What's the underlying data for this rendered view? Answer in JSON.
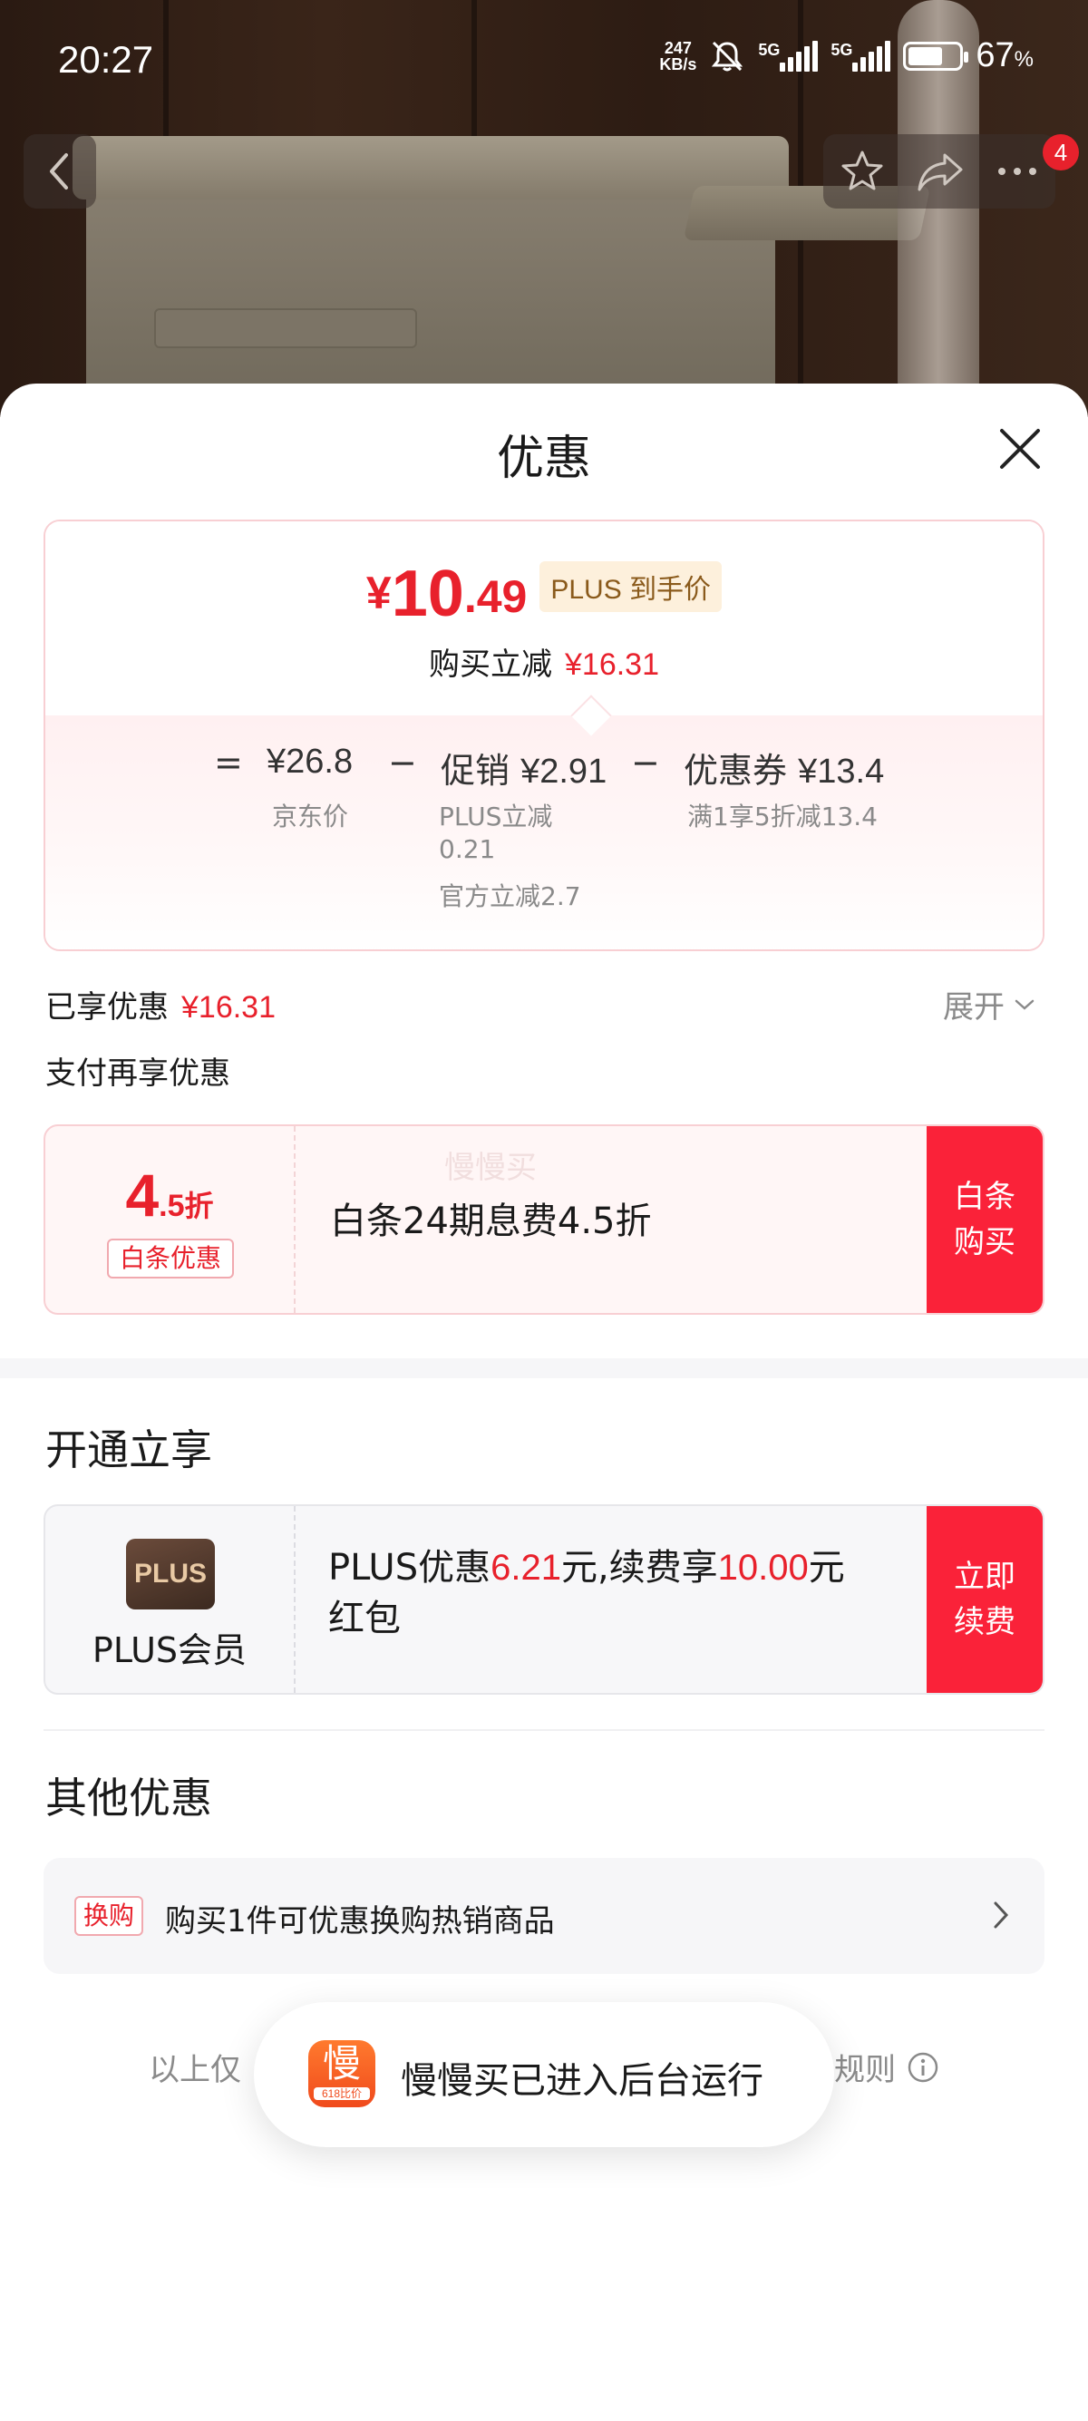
{
  "status_bar": {
    "time": "20:27",
    "net_speed_value": "247",
    "net_speed_unit": "KB/s",
    "signal1_label": "5G",
    "signal2_label": "5G",
    "battery_level": 0.67,
    "battery_pct": "67",
    "battery_pct_unit": "%"
  },
  "nav": {
    "badge_count": "4"
  },
  "sheet": {
    "title": "优惠"
  },
  "price_card": {
    "currency": "¥",
    "price_int": "10",
    "price_dec": ".49",
    "plus_tag_prefix": "PLUS",
    "plus_tag_suffix": "到手价",
    "reduce_label": "购买立减",
    "reduce_value": "¥16.31",
    "eq_sign": "=",
    "jd_price": "¥26.8",
    "jd_price_label": "京东价",
    "minus1": "−",
    "promo_label": "促销",
    "promo_value": "¥2.91",
    "promo_detail1_a": "PLUS立减",
    "promo_detail1_b": "0.21",
    "promo_detail2": "官方立减2.7",
    "minus2": "−",
    "coupon_label": "优惠券",
    "coupon_value": "¥13.4",
    "coupon_detail": "满1享5折减13.4"
  },
  "enjoyed": {
    "label": "已享优惠",
    "value": "¥16.31",
    "expand_label": "展开"
  },
  "pay_more": {
    "label": "支付再享优惠"
  },
  "baitiao": {
    "rate_big": "4",
    "rate_small": ".5",
    "rate_unit": "折",
    "tag": "白条优惠",
    "text": "白条24期息费4.5折",
    "watermark": "慢慢买",
    "button_line1": "白条",
    "button_line2": "购买"
  },
  "open_section": {
    "title": "开通立享"
  },
  "plus_card": {
    "logo_text": "PLUS",
    "member_label": "PLUS会员",
    "text_a": "PLUS优惠",
    "value_a": "6.21",
    "text_b": "元,续费享",
    "value_b": "10.00",
    "text_c": "元",
    "text_d": "红包",
    "button_line1": "立即",
    "button_line2": "续费"
  },
  "other_section": {
    "title": "其他优惠",
    "tag": "换购",
    "text": "购买1件可优惠换购热销商品"
  },
  "footer": {
    "note": "以上仅",
    "rule": "规则"
  },
  "toast": {
    "logo_char": "慢",
    "logo_sub": "618比价",
    "text": "慢慢买已进入后台运行"
  }
}
